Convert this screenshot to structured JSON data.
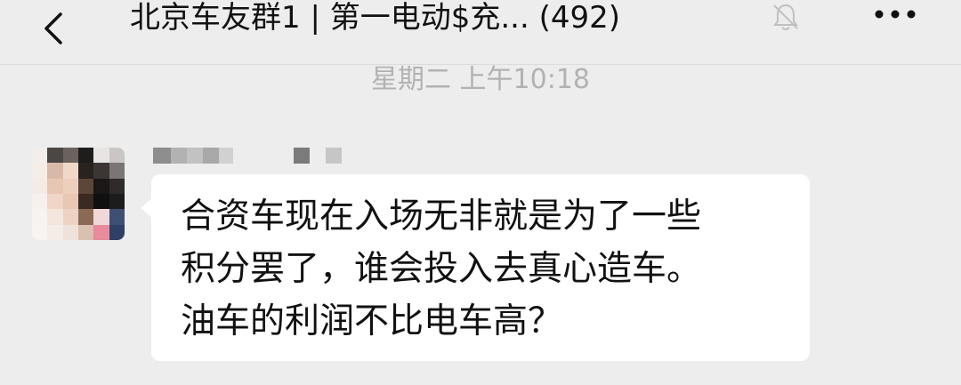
{
  "header": {
    "title": "北京车友群1 | 第一电动$充... (492)",
    "back_icon": "chevron-left-icon",
    "mute_icon": "bell-muted-icon",
    "more_icon": "more-dots-icon"
  },
  "chat": {
    "timestamp": "星期二 上午10:18",
    "messages": [
      {
        "avatar": "pixelated-avatar",
        "text": "合资车现在入场无非就是为了一些\n积分罢了，谁会投入去真心造车。\n油车的利润不比电车高？"
      }
    ]
  },
  "colors": {
    "background": "#ededed",
    "bubble": "#ffffff",
    "timestamp": "#b2b2b2",
    "text": "#111111"
  }
}
